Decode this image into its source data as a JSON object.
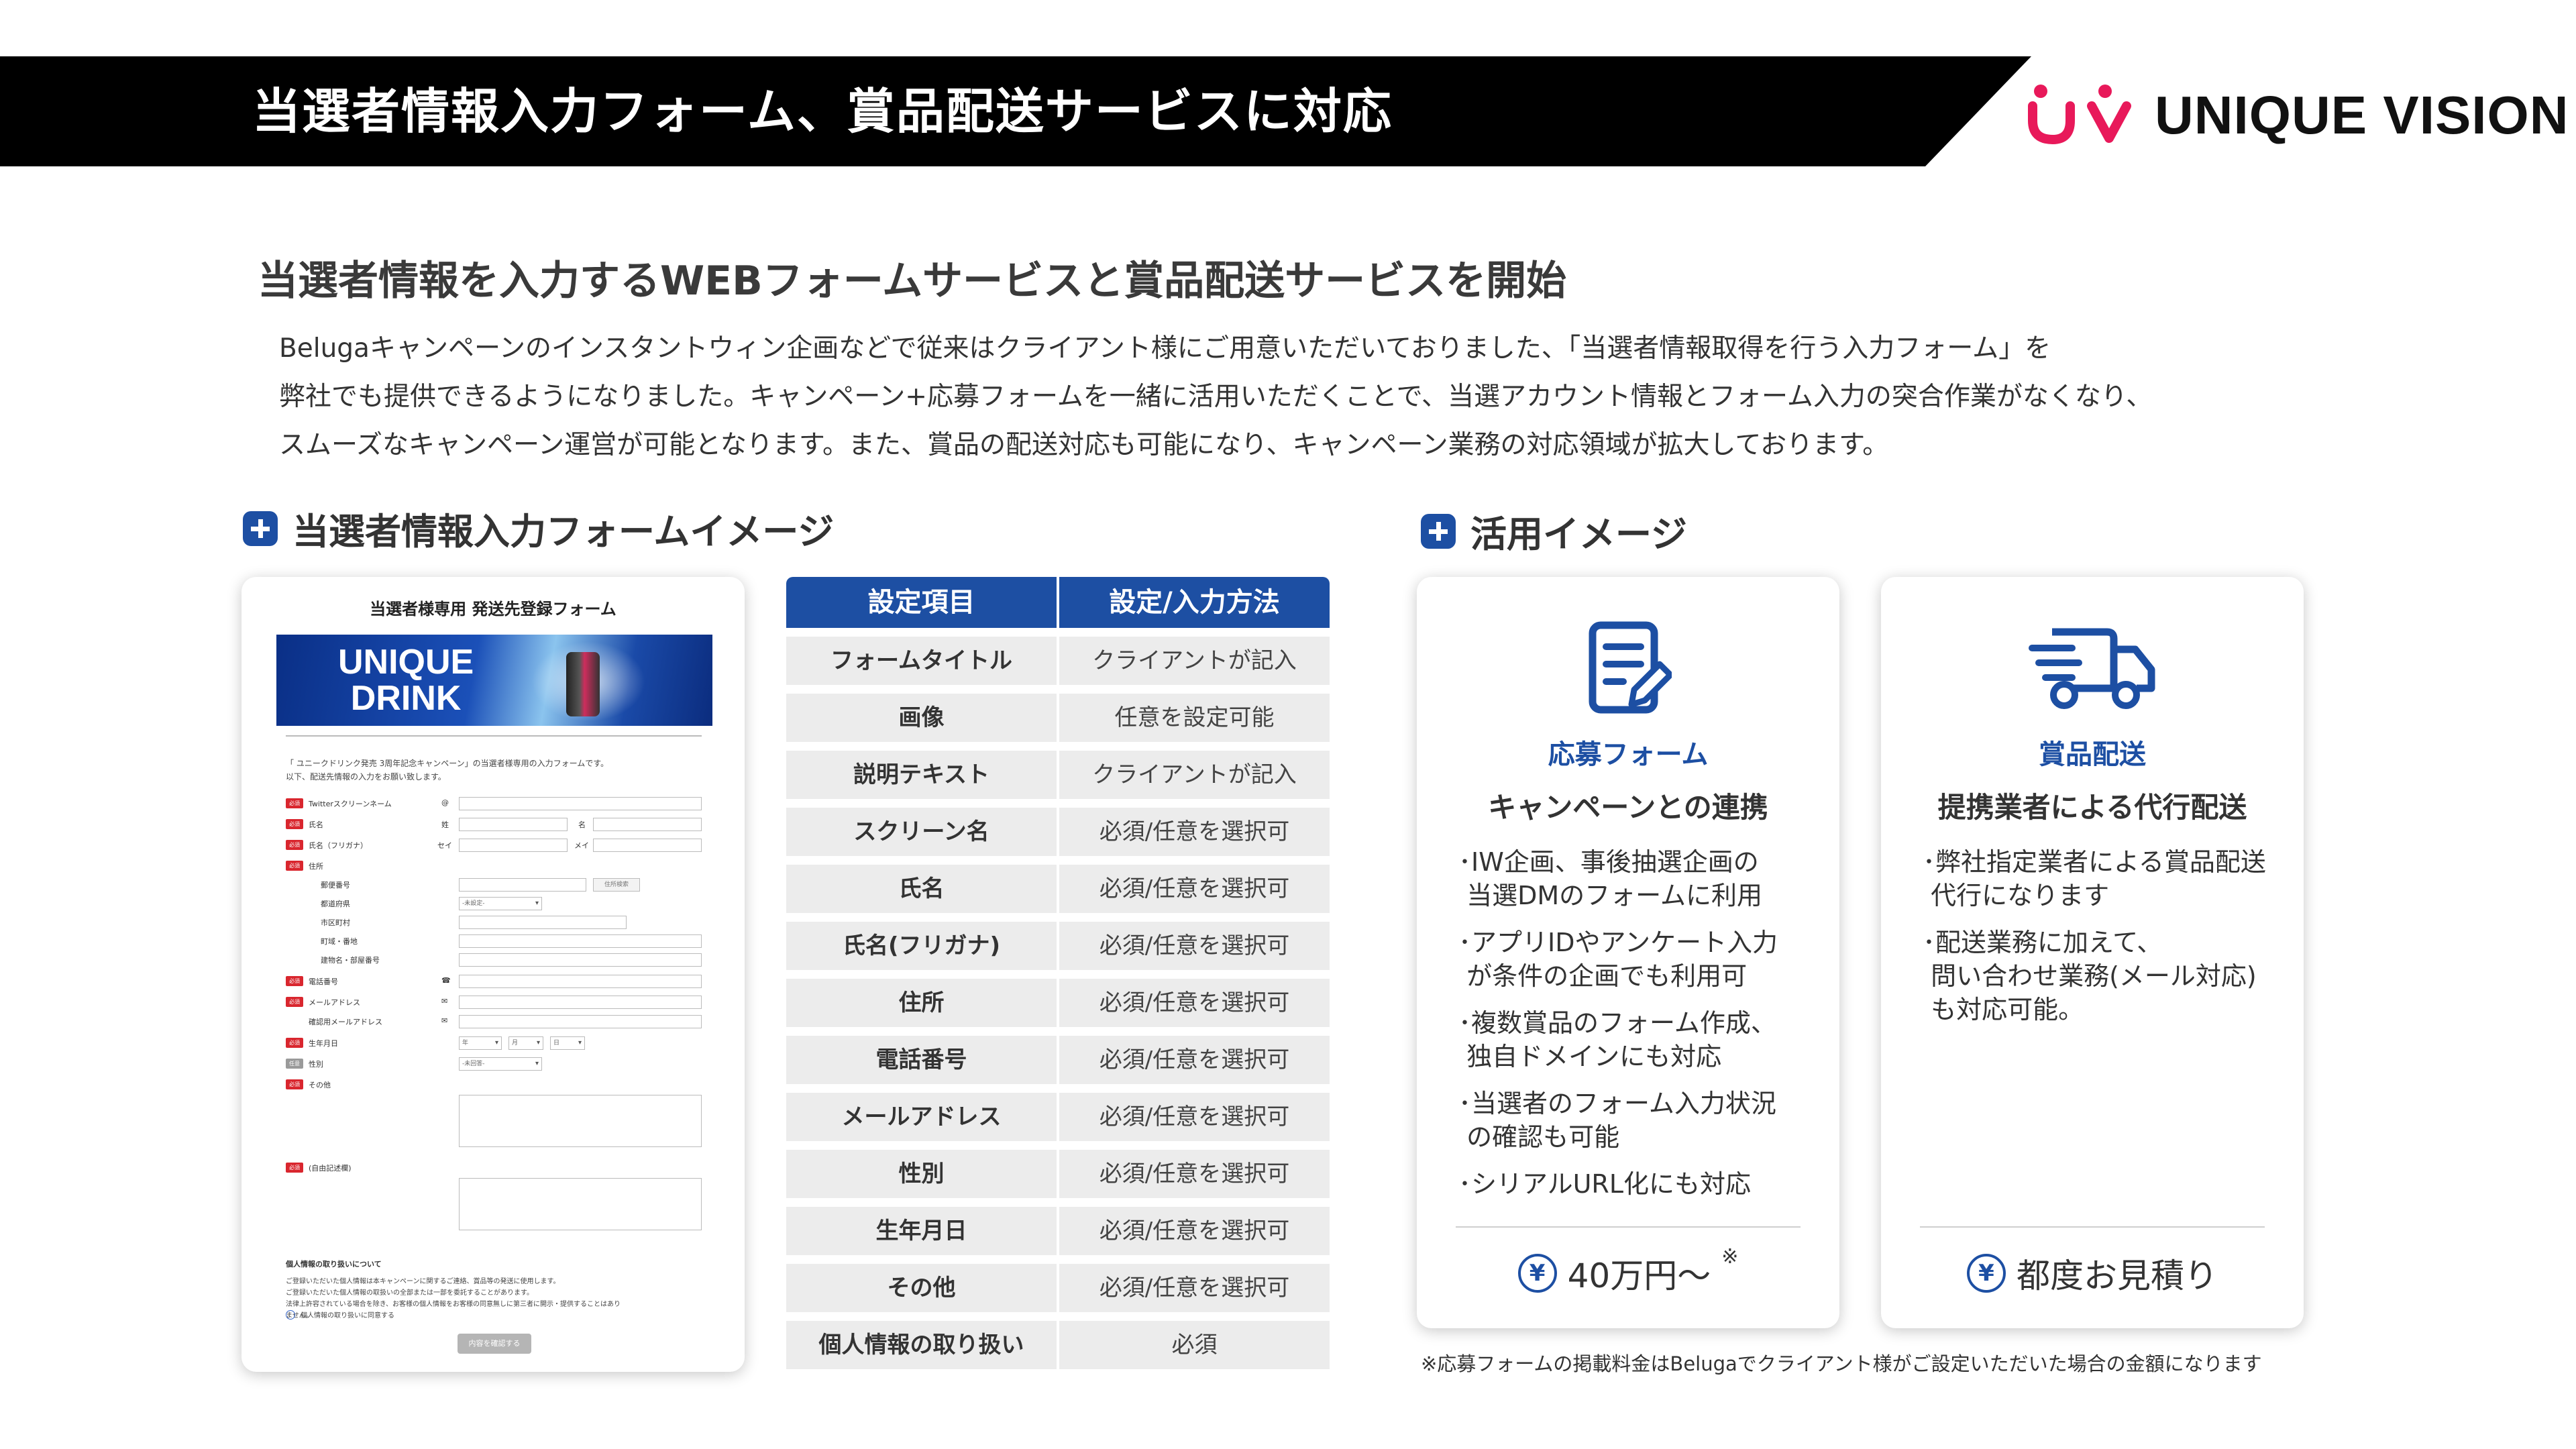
{
  "header": {
    "title": "当選者情報入力フォーム、賞品配送サービスに対応",
    "logo_text": "UNIQUE VISION"
  },
  "main_heading": "当選者情報を入力するWEBフォームサービスと賞品配送サービスを開始",
  "intro_lines": [
    "Belugaキャンペーンのインスタントウィン企画などで従来はクライアント様にご用意いただいておりました、「当選者情報取得を行う入力フォーム」を",
    "弊社でも提供できるようになりました。キャンペーン+応募フォームを一緒に活用いただくことで、当選アカウント情報とフォーム入力の突合作業がなくなり、",
    "スムーズなキャンペーン運営が可能となります。また、賞品の配送対応も可能になり、キャンペーン業務の対応領域が拡大しております。"
  ],
  "sections": {
    "form_image": "当選者情報入力フォームイメージ",
    "usage_image": "活用イメージ"
  },
  "form_mock": {
    "title": "当選者様専用 発送先登録フォーム",
    "banner_text": "UNIQUE\nDRINK",
    "lead": "「 ユニークドリンク発売 3周年記念キャンペーン」の当選者様専用の入力フォームです。\n以下、配送先情報の入力をお願い致します。",
    "required_badge": "必須",
    "optional_badge": "任意",
    "labels": {
      "twitter": "Twitterスクリーンネーム",
      "name": "氏名",
      "kana": "氏名（フリガナ）",
      "address": "住所",
      "zip": "郵便番号",
      "pref": "都道府県",
      "city": "市区町村",
      "street": "町域・番地",
      "building": "建物名・部屋番号",
      "phone": "電話番号",
      "email": "メールアドレス",
      "email_confirm": "確認用メールアドレス",
      "birthday": "生年月日",
      "gender": "性別",
      "other": "その他",
      "free": "(自由記述欄)"
    },
    "marks": {
      "at": "@",
      "sei": "姓",
      "mei": "名",
      "sei_kana": "セイ",
      "mei_kana": "メイ",
      "phone_icon": "☎",
      "mail_icon": "✉"
    },
    "zip_button": "住所検索",
    "pref_placeholder": "-未設定-",
    "gender_placeholder": "-未回答-",
    "date_year": "年",
    "date_month": "月",
    "date_day": "日",
    "privacy_heading": "個人情報の取り扱いについて",
    "privacy_text": "ご登録いただいた個人情報は本キャンペーンに関するご連絡、賞品等の発送に使用します。\nご登録いただいた個人情報の取扱いの全部または一部を委託することがあります。\n法律上許容されている場合を除き、お客様の個人情報をお客様の同意無しに第三者に開示・提供することはあり\nません。",
    "consent": "個人情報の取り扱いに同意する",
    "submit": "内容を確認する"
  },
  "settings_table": {
    "headers": [
      "設定項目",
      "設定/入力方法"
    ],
    "rows": [
      [
        "フォームタイトル",
        "クライアントが記入"
      ],
      [
        "画像",
        "任意を設定可能"
      ],
      [
        "説明テキスト",
        "クライアントが記入"
      ],
      [
        "スクリーン名",
        "必須/任意を選択可"
      ],
      [
        "氏名",
        "必須/任意を選択可"
      ],
      [
        "氏名(フリガナ)",
        "必須/任意を選択可"
      ],
      [
        "住所",
        "必須/任意を選択可"
      ],
      [
        "電話番号",
        "必須/任意を選択可"
      ],
      [
        "メールアドレス",
        "必須/任意を選択可"
      ],
      [
        "性別",
        "必須/任意を選択可"
      ],
      [
        "生年月日",
        "必須/任意を選択可"
      ],
      [
        "その他",
        "必須/任意を選択可"
      ],
      [
        "個人情報の取り扱い",
        "必須"
      ]
    ]
  },
  "usage_cards": [
    {
      "icon": "form-icon",
      "name": "応募フォーム",
      "subtitle": "キャンペーンとの連携",
      "points": [
        "･IW企画、事後抽選企画の\n 当選DMのフォームに利用",
        "･アプリIDやアンケート入力\n が条件の企画でも利用可",
        "･複数賞品のフォーム作成、\n 独自ドメインにも対応",
        "･当選者のフォーム入力状況\n の確認も可能",
        "･シリアルURL化にも対応"
      ],
      "price": "40万円〜",
      "price_note": "※"
    },
    {
      "icon": "truck-icon",
      "name": "賞品配送",
      "subtitle": "提携業者による代行配送",
      "points": [
        "･弊社指定業者による賞品配送\n 代行になります",
        "･配送業務に加えて、\n 問い合わせ業務(メール対応)\n も対応可能。"
      ],
      "price": "都度お見積り",
      "price_note": ""
    }
  ],
  "yen_symbol": "¥",
  "footnote": "※応募フォームの掲載料金はBelugaでクライアント様がご設定いただいた場合の金額になります",
  "colors": {
    "accent_blue": "#1d4fa3",
    "logo_pink": "#e8195a",
    "header_black": "#000000",
    "table_gray": "#ececec"
  }
}
